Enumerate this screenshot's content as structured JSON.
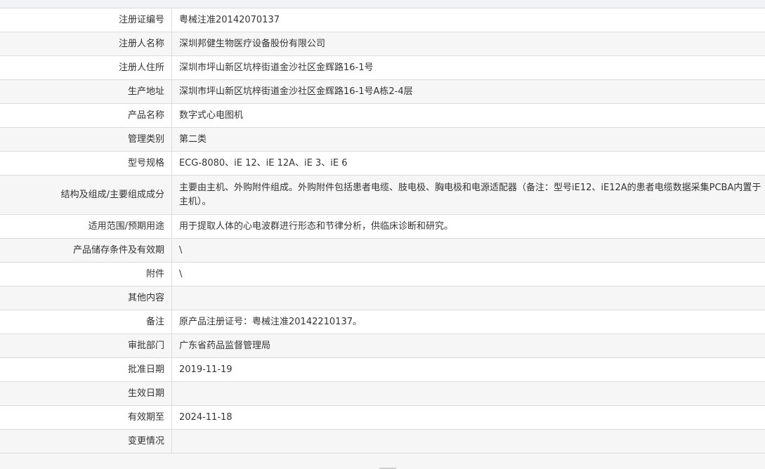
{
  "rows": [
    {
      "label": "注册证编号",
      "value": "粤械注准20142070137"
    },
    {
      "label": "注册人名称",
      "value": "深圳邦健生物医疗设备股份有限公司"
    },
    {
      "label": "注册人住所",
      "value": "深圳市坪山新区坑梓街道金沙社区金辉路16-1号"
    },
    {
      "label": "生产地址",
      "value": "深圳市坪山新区坑梓街道金沙社区金辉路16-1号A栋2-4层"
    },
    {
      "label": "产品名称",
      "value": "数字式心电图机"
    },
    {
      "label": "管理类别",
      "value": "第二类"
    },
    {
      "label": "型号规格",
      "value": "ECG-8080、iE 12、iE 12A、iE 3、iE 6"
    },
    {
      "label": "结构及组成/主要组成成分",
      "value": "主要由主机、外购附件组成。外购附件包括患者电缆、肢电极、胸电极和电源适配器（备注：型号iE12、iE12A的患者电缆数据采集PCBA内置于主机）。"
    },
    {
      "label": "适用范围/预期用途",
      "value": "用于提取人体的心电波群进行形态和节律分析，供临床诊断和研究。"
    },
    {
      "label": "产品储存条件及有效期",
      "value": "\\"
    },
    {
      "label": "附件",
      "value": "\\"
    },
    {
      "label": "其他内容",
      "value": ""
    },
    {
      "label": "备注",
      "value": "原产品注册证号：粤械注准20142210137。"
    },
    {
      "label": "审批部门",
      "value": "广东省药品监督管理局"
    },
    {
      "label": "批准日期",
      "value": "2019-11-19"
    },
    {
      "label": "生效日期",
      "value": ""
    },
    {
      "label": "有效期至",
      "value": "2024-11-18"
    },
    {
      "label": "变更情况",
      "value": ""
    }
  ]
}
